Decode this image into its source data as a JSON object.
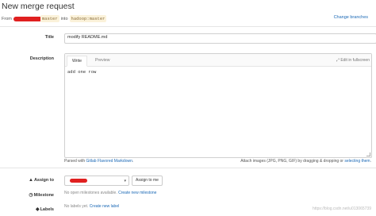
{
  "page": {
    "title": "New merge request",
    "from_prefix": "From",
    "source_branch": "master",
    "into_text": "into",
    "target_branch": "hadoop:master",
    "change_branches": "Change branches"
  },
  "form": {
    "title_label": "Title",
    "title_value": "modify README.md",
    "description_label": "Description",
    "tab_write": "Write",
    "tab_preview": "Preview",
    "edit_fullscreen": "Edit in fullscreen",
    "description_value": "add one row",
    "parsed_with": "Parsed with",
    "markdown_link": "Gitlab Flavored Markdown",
    "attach_text": "Attach images (JPG, PNG, GIF) by dragging & dropping or",
    "attach_link": "selecting them"
  },
  "assign": {
    "label": "Assign to",
    "assign_me": "Assign to me"
  },
  "milestone": {
    "label": "Milestone",
    "none_text": "No open milestones available.",
    "create_link": "Create new milestone"
  },
  "labels": {
    "label": "Labels",
    "none_text": "No labels yet.",
    "create_link": "Create new label"
  },
  "watermark": "https://blog.csdn.net/u013065739",
  "colors": {
    "link": "#1b69b6",
    "redaction": "#e02020",
    "branch_bg": "#fbf2da"
  }
}
